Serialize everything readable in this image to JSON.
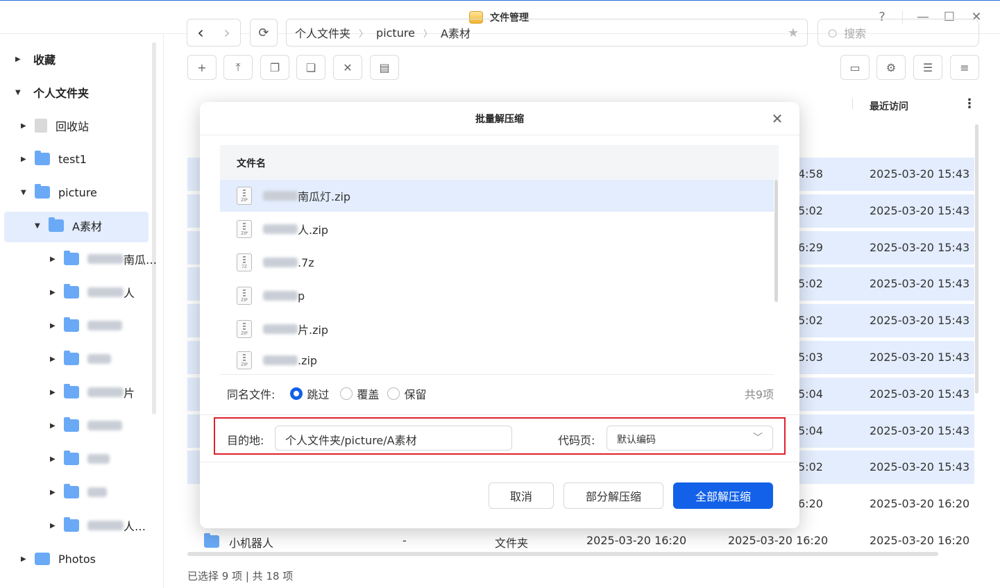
{
  "window": {
    "title": "文件管理",
    "help": "?",
    "minimize": "—",
    "maximize": "☐",
    "close": "✕"
  },
  "sidebar": {
    "favorites": "收藏",
    "personal": "个人文件夹",
    "recycle": "回收站",
    "test1": "test1",
    "picture": "picture",
    "a_material": "A素材",
    "sub_items": [
      "南瓜…",
      "人",
      "",
      "",
      "片",
      "",
      "",
      "",
      "人…"
    ],
    "photos": "Photos"
  },
  "toolbar": {
    "back": "‹",
    "forward": "›",
    "refresh": "⟳",
    "path": [
      "个人文件夹",
      "picture",
      "A素材"
    ],
    "search_placeholder": "搜索",
    "new": "+"
  },
  "table": {
    "col_recent": "最近访问",
    "rows": [
      {
        "mod": "4:58",
        "recent": "2025-03-20 15:43"
      },
      {
        "mod": "5:02",
        "recent": "2025-03-20 15:43"
      },
      {
        "mod": "6:29",
        "recent": "2025-03-20 15:43"
      },
      {
        "mod": "5:02",
        "recent": "2025-03-20 15:43"
      },
      {
        "mod": "5:02",
        "recent": "2025-03-20 15:43"
      },
      {
        "mod": "5:03",
        "recent": "2025-03-20 15:43"
      },
      {
        "mod": "5:04",
        "recent": "2025-03-20 15:43"
      },
      {
        "mod": "5:04",
        "recent": "2025-03-20 15:43"
      },
      {
        "mod": "5:02",
        "recent": "2025-03-20 15:43"
      },
      {
        "mod": "6:20",
        "recent": "2025-03-20 16:20"
      }
    ],
    "last_row": {
      "name": "小机器人",
      "size": "-",
      "type": "文件夹",
      "created": "2025-03-20 16:20",
      "modified": "2025-03-20 16:20",
      "recent": "2025-03-20 16:20"
    }
  },
  "status": "已选择 9 项 | 共 18 项",
  "modal": {
    "title": "批量解压缩",
    "col_filename": "文件名",
    "files": [
      "南瓜灯.zip",
      "人.zip",
      ".7z",
      "p",
      "片.zip",
      ".zip"
    ],
    "same_name_label": "同名文件:",
    "options": [
      "跳过",
      "覆盖",
      "保留"
    ],
    "total": "共9项",
    "dest_label": "目的地:",
    "dest_value": "个人文件夹/picture/A素材",
    "codepage_label": "代码页:",
    "codepage_value": "默认编码",
    "cancel": "取消",
    "partial": "部分解压缩",
    "all": "全部解压缩"
  }
}
